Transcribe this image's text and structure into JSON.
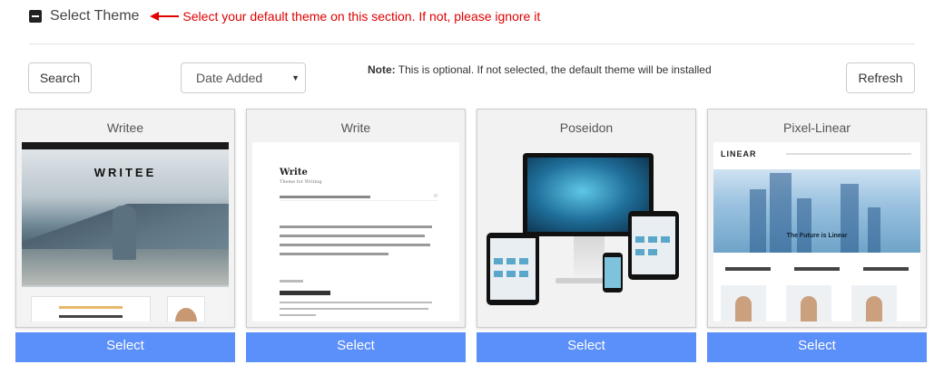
{
  "header": {
    "title": "Select Theme",
    "hint": "Select your default theme on this section. If not, please ignore it"
  },
  "toolbar": {
    "search_label": "Search",
    "sort_selected": "Date Added",
    "refresh_label": "Refresh",
    "note_label": "Note:",
    "note_text": " This is optional. If not selected, the default theme will be installed"
  },
  "themes": [
    {
      "name": "Writee",
      "select_label": "Select",
      "logo_text": "WRITEE"
    },
    {
      "name": "Write",
      "select_label": "Select",
      "site_title": "Write",
      "tagline": "Theme for Writing"
    },
    {
      "name": "Poseidon",
      "select_label": "Select"
    },
    {
      "name": "Pixel-Linear",
      "select_label": "Select",
      "logo_text": "LINEAR",
      "hero_text": "The Future is Linear"
    }
  ],
  "colors": {
    "accent_blue": "#5b8ff9",
    "hint_red": "#e00000"
  }
}
